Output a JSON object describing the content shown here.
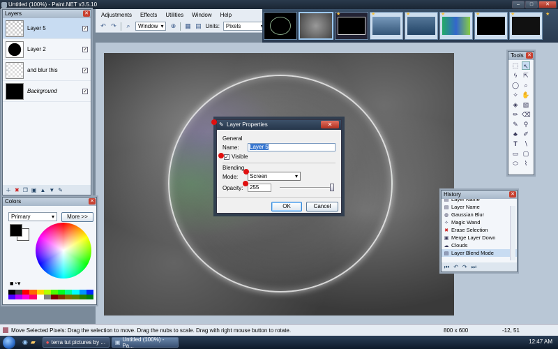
{
  "window": {
    "title": "Untitled (100%) - Paint.NET v3.5.10"
  },
  "menu": [
    "Adjustments",
    "Effects",
    "Utilities",
    "Window",
    "Help"
  ],
  "toolbar": {
    "zoom_mode": "Window",
    "units_label": "Units:",
    "units_value": "Pixels"
  },
  "layers": {
    "title": "Layers",
    "items": [
      {
        "name": "Layer 5",
        "visible": true,
        "selected": true
      },
      {
        "name": "Layer 2",
        "visible": true,
        "selected": false
      },
      {
        "name": "and blur this",
        "visible": true,
        "selected": false
      },
      {
        "name": "Background",
        "visible": true,
        "selected": false
      }
    ]
  },
  "colors": {
    "title": "Colors",
    "mode": "Primary",
    "more_button": "More >>",
    "primary": "#000000",
    "secondary": "#ffffff",
    "palette": [
      "#000000",
      "#404040",
      "#ff0000",
      "#ff6a00",
      "#ffd800",
      "#b6ff00",
      "#4cff00",
      "#00ff21",
      "#00ff90",
      "#00ffff",
      "#0094ff",
      "#0026ff",
      "#4800ff",
      "#b200ff",
      "#ff00dc",
      "#ff006e",
      "#ffffff",
      "#808080",
      "#7f0000",
      "#7f3300",
      "#7f6a00",
      "#5b7f00",
      "#267f00",
      "#007f0e"
    ]
  },
  "tools": {
    "title": "Tools",
    "icons": [
      "rect-select-icon",
      "move-selection-icon",
      "lasso-icon",
      "move-pixels-icon",
      "ellipse-select-icon",
      "zoom-icon",
      "magic-wand-icon",
      "pan-icon",
      "paint-bucket-icon",
      "gradient-icon",
      "paintbrush-icon",
      "eraser-icon",
      "pencil-icon",
      "color-picker-icon",
      "clone-stamp-icon",
      "recolor-icon",
      "text-icon",
      "line-curve-icon",
      "rectangle-icon",
      "rounded-rect-icon",
      "ellipse-icon",
      "freeform-shape-icon"
    ]
  },
  "history": {
    "title": "History",
    "items": [
      "Layer Name",
      "Layer Name",
      "Gaussian Blur",
      "Magic Wand",
      "Erase Selection",
      "Merge Layer Down",
      "Clouds",
      "Layer Blend Mode"
    ]
  },
  "dialog": {
    "title": "Layer Properties",
    "general_label": "General",
    "name_label": "Name:",
    "name_value": "Layer 5",
    "visible_label": "Visible",
    "blending_label": "Blending",
    "mode_label": "Mode:",
    "mode_value": "Screen",
    "opacity_label": "Opacity:",
    "opacity_value": "255",
    "opacity_fraction": 1.0,
    "ok_label": "OK",
    "cancel_label": "Cancel"
  },
  "status": {
    "message": "Move Selected Pixels: Drag the selection to move. Drag the nubs to scale. Drag with right mouse button to rotate.",
    "image_size": "800 x 600",
    "cursor": "-12, 51"
  },
  "taskbar": {
    "tasks": [
      "terra tut pictures by ...",
      "Untitled (100%) - Pa..."
    ],
    "clock": "12:47 AM"
  }
}
